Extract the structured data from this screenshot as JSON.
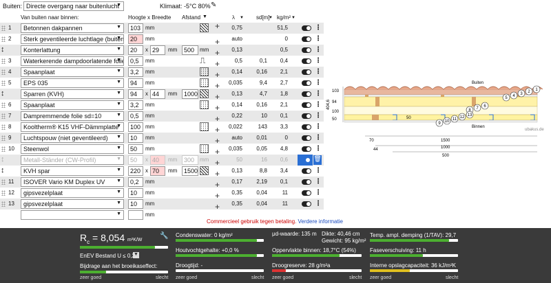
{
  "top": {
    "buiten_label": "Buiten:",
    "buiten_value": "Directe overgang naar buitenlucht",
    "klimaat_label": "Klimaat: -5°C 80%"
  },
  "headers": {
    "van_buiten": "Van buiten naar binnen:",
    "hoogte_breedte": "Hoogte x Breedte",
    "afstand": "Afstand",
    "lambda": "λ",
    "sd": "sd[m]",
    "kgm2": "kg/m²"
  },
  "rows": [
    {
      "num": "1",
      "name": "Betonnen dakpannen",
      "h": "103",
      "unit": "mm",
      "lambda": "0,75",
      "sd": "",
      "kg": "51,5"
    },
    {
      "num": "2",
      "name": "Sterk geventileerde luchtlage (buiten)",
      "h": "20",
      "unit": "mm",
      "lambda": "auto",
      "sd": "",
      "kg": "0"
    },
    {
      "num": "",
      "name": "Konterlattung",
      "h": "20",
      "x": "x",
      "w": "29",
      "unit": "mm",
      "afstand": "500",
      "unit2": "mm",
      "lambda": "0,13",
      "sd": "",
      "kg": "0,5"
    },
    {
      "num": "3",
      "name": "Waterkerende dampdoorlatende folie",
      "h": "0,5",
      "unit": "mm",
      "lambda": "0,5",
      "sd": "0,1",
      "kg": "0,4"
    },
    {
      "num": "4",
      "name": "Spaanplaat",
      "h": "3,2",
      "unit": "mm",
      "lambda": "0,14",
      "sd": "0,16",
      "kg": "2,1"
    },
    {
      "num": "5",
      "name": "EPS 035",
      "h": "94",
      "unit": "mm",
      "lambda": "0,035",
      "sd": "9,4",
      "kg": "2,7"
    },
    {
      "num": "",
      "name": "Sparren (KVH)",
      "h": "94",
      "x": "x",
      "w": "44",
      "unit": "mm",
      "afstand": "1000",
      "unit2": "mm",
      "lambda": "0,13",
      "sd": "4,7",
      "kg": "1,8"
    },
    {
      "num": "6",
      "name": "Spaanplaat",
      "h": "3,2",
      "unit": "mm",
      "lambda": "0,14",
      "sd": "0,16",
      "kg": "2,1"
    },
    {
      "num": "7",
      "name": "Dampremmende folie sd=10",
      "h": "0,5",
      "unit": "mm",
      "lambda": "0,22",
      "sd": "10",
      "kg": "0,1"
    },
    {
      "num": "8",
      "name": "Kooltherm® K15 VHF-Dämmplatte",
      "h": "100",
      "unit": "mm",
      "lambda": "0,022",
      "sd": "143",
      "kg": "3,3"
    },
    {
      "num": "9",
      "name": "Luchtspouw (niet geventileerd)",
      "h": "10",
      "unit": "mm",
      "lambda": "auto",
      "sd": "0,01",
      "kg": "0"
    },
    {
      "num": "10",
      "name": "Steenwol",
      "h": "50",
      "unit": "mm",
      "lambda": "0,035",
      "sd": "0,05",
      "kg": "4,8"
    },
    {
      "num": "",
      "name": "Metall-Ständer (CW-Profil)",
      "h": "50",
      "x": "x",
      "w": "40",
      "unit": "mm",
      "afstand": "300",
      "unit2": "mm",
      "lambda": "50",
      "sd": "16",
      "kg": "0,6"
    },
    {
      "num": "",
      "name": "KVH spar",
      "h": "220",
      "x": "x",
      "w": "70",
      "unit": "mm",
      "afstand": "1500",
      "unit2": "mm",
      "lambda": "0,13",
      "sd": "8,8",
      "kg": "3,4"
    },
    {
      "num": "11",
      "name": "ISOVER Vario KM Duplex UV",
      "h": "0,2",
      "unit": "mm",
      "lambda": "0,17",
      "sd": "2,19",
      "kg": "0,1"
    },
    {
      "num": "12",
      "name": "gipsvezelplaat",
      "h": "10",
      "unit": "mm",
      "lambda": "0,35",
      "sd": "0,04",
      "kg": "11"
    },
    {
      "num": "13",
      "name": "gipsvezelplaat",
      "h": "10",
      "unit": "mm",
      "lambda": "0,35",
      "sd": "0,04",
      "kg": "11"
    }
  ],
  "commercial": {
    "text": "Commercieel gebruik tegen betaling.",
    "link": "Verdere informatie"
  },
  "drawing": {
    "buiten": "Buiten",
    "binnen": "Binnen",
    "site": "ubakus.de",
    "dim_103": "103",
    "dim_94": "94",
    "dim_100": "100",
    "dim_50": "50",
    "dim_total": "404,6",
    "inner_50": "50",
    "dim_70": "70",
    "dim_1500": "1500",
    "dim_44": "44",
    "dim_1000": "1000",
    "dim_500": "500",
    "layer_nums_top": [
      "1",
      "2",
      "3",
      "4",
      "5"
    ],
    "layer_nums_mid": [
      "6",
      "7",
      "8"
    ],
    "layer_nums_low": [
      "9",
      "10",
      "11",
      "12",
      "13"
    ]
  },
  "results": {
    "rc_label": "R",
    "rc_sub": "c",
    "rc_eq": "=",
    "rc_value": "8,054",
    "rc_unit": "m²K/W",
    "enev": "EnEV Bestand U ≤ 0,24",
    "bijdrage": "Bijdrage aan het broeikaseffect:",
    "condens": "Condenswater: 0 kg/m²",
    "houtvocht": "Houtvochtgehalte: +0,0 %",
    "droogtijd": "Droogtijd: -",
    "mud": "μd-waarde: 135 m",
    "dikte": "Dikte: 40,46 cm",
    "gewicht": "Gewicht: 95 kg/m²",
    "oppervlakte": "Oppervlakte binnen: 18,7°C (54%)",
    "droogreserve": "Droogreserve: 28 g/m²a",
    "temp_ampl": "Temp. ampl. demping (1/TAV): 29,7",
    "faseverschuiving": "Faseverschuiving: 11 h",
    "interne": "Interne opslagcapaciteit: 36 kJ/m²K",
    "zeer_goed": "zeer goed",
    "slecht": "slecht",
    "rc_fill": 0.85,
    "broeikas_fill": 0.3,
    "condens_fill": 0.92,
    "houtvocht_fill": 0.92,
    "droogtijd_fill": 0.0,
    "oppervlakte_fill": 0.75,
    "droogreserve_fill": 0.15,
    "temp_fill": 0.9,
    "fase_fill": 0.6,
    "interne_fill": 0.45
  }
}
